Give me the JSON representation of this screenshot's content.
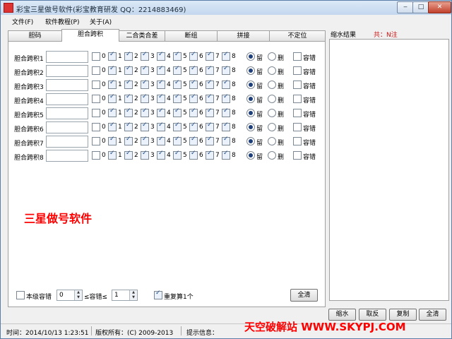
{
  "window": {
    "title": "彩宝三星做号软件(彩宝教育研发 QQ：2214883469)",
    "minimize": "‒",
    "maximize": "□",
    "close": "✕"
  },
  "menu": [
    "文件(F)",
    "软件教程(P)",
    "关于(A)"
  ],
  "tabs": [
    {
      "label": "胆码",
      "active": false
    },
    {
      "label": "胆合跨积",
      "active": true
    },
    {
      "label": "二合类合差",
      "active": false
    },
    {
      "label": "断组",
      "active": false
    },
    {
      "label": "拼接",
      "active": false
    },
    {
      "label": "不定位",
      "active": false
    }
  ],
  "digits": [
    "0",
    "1",
    "2",
    "3",
    "4",
    "5",
    "6",
    "7",
    "8"
  ],
  "rows": [
    {
      "label": "胆合跨积1",
      "value": "",
      "checked": [
        false,
        true,
        true,
        true,
        true,
        true,
        true,
        true,
        true
      ],
      "keep": true,
      "tolerance": false
    },
    {
      "label": "胆合跨积2",
      "value": "",
      "checked": [
        false,
        true,
        true,
        true,
        true,
        true,
        true,
        true,
        true
      ],
      "keep": true,
      "tolerance": false
    },
    {
      "label": "胆合跨积3",
      "value": "",
      "checked": [
        false,
        true,
        true,
        true,
        true,
        true,
        true,
        true,
        true
      ],
      "keep": true,
      "tolerance": false
    },
    {
      "label": "胆合跨积4",
      "value": "",
      "checked": [
        false,
        true,
        true,
        true,
        true,
        true,
        true,
        true,
        true
      ],
      "keep": true,
      "tolerance": false
    },
    {
      "label": "胆合跨积5",
      "value": "",
      "checked": [
        false,
        true,
        true,
        true,
        true,
        true,
        true,
        true,
        true
      ],
      "keep": true,
      "tolerance": false
    },
    {
      "label": "胆合跨积6",
      "value": "",
      "checked": [
        false,
        true,
        true,
        true,
        true,
        true,
        true,
        true,
        true
      ],
      "keep": true,
      "tolerance": false
    },
    {
      "label": "胆合跨积7",
      "value": "",
      "checked": [
        false,
        true,
        true,
        true,
        true,
        true,
        true,
        true,
        true
      ],
      "keep": true,
      "tolerance": false
    },
    {
      "label": "胆合跨积8",
      "value": "",
      "checked": [
        false,
        true,
        true,
        true,
        true,
        true,
        true,
        true,
        true
      ],
      "keep": true,
      "tolerance": false
    }
  ],
  "keep_label": "留",
  "delete_label": "删",
  "tolerance_label": "容错",
  "overlay_text": "三星做号软件",
  "bottom": {
    "level_tolerance_label": "本级容错",
    "level_tolerance_checked": false,
    "min_value": "0",
    "range_label": "≤容错≤",
    "max_value": "1",
    "repeat_label": "重复算1个",
    "repeat_checked": true,
    "select_all_label": "全清"
  },
  "right": {
    "result_label": "缩水结果",
    "result_count": "共：N注",
    "buttons": [
      "缩水",
      "取反",
      "复制",
      "全清"
    ]
  },
  "status": {
    "time": "时间：2014/10/13 1:23:51",
    "copyright": "版权所有：(C) 2009-2013",
    "hint": "提示信息："
  },
  "site_watermark": "天空破解站 WWW.SKYPJ.COM"
}
